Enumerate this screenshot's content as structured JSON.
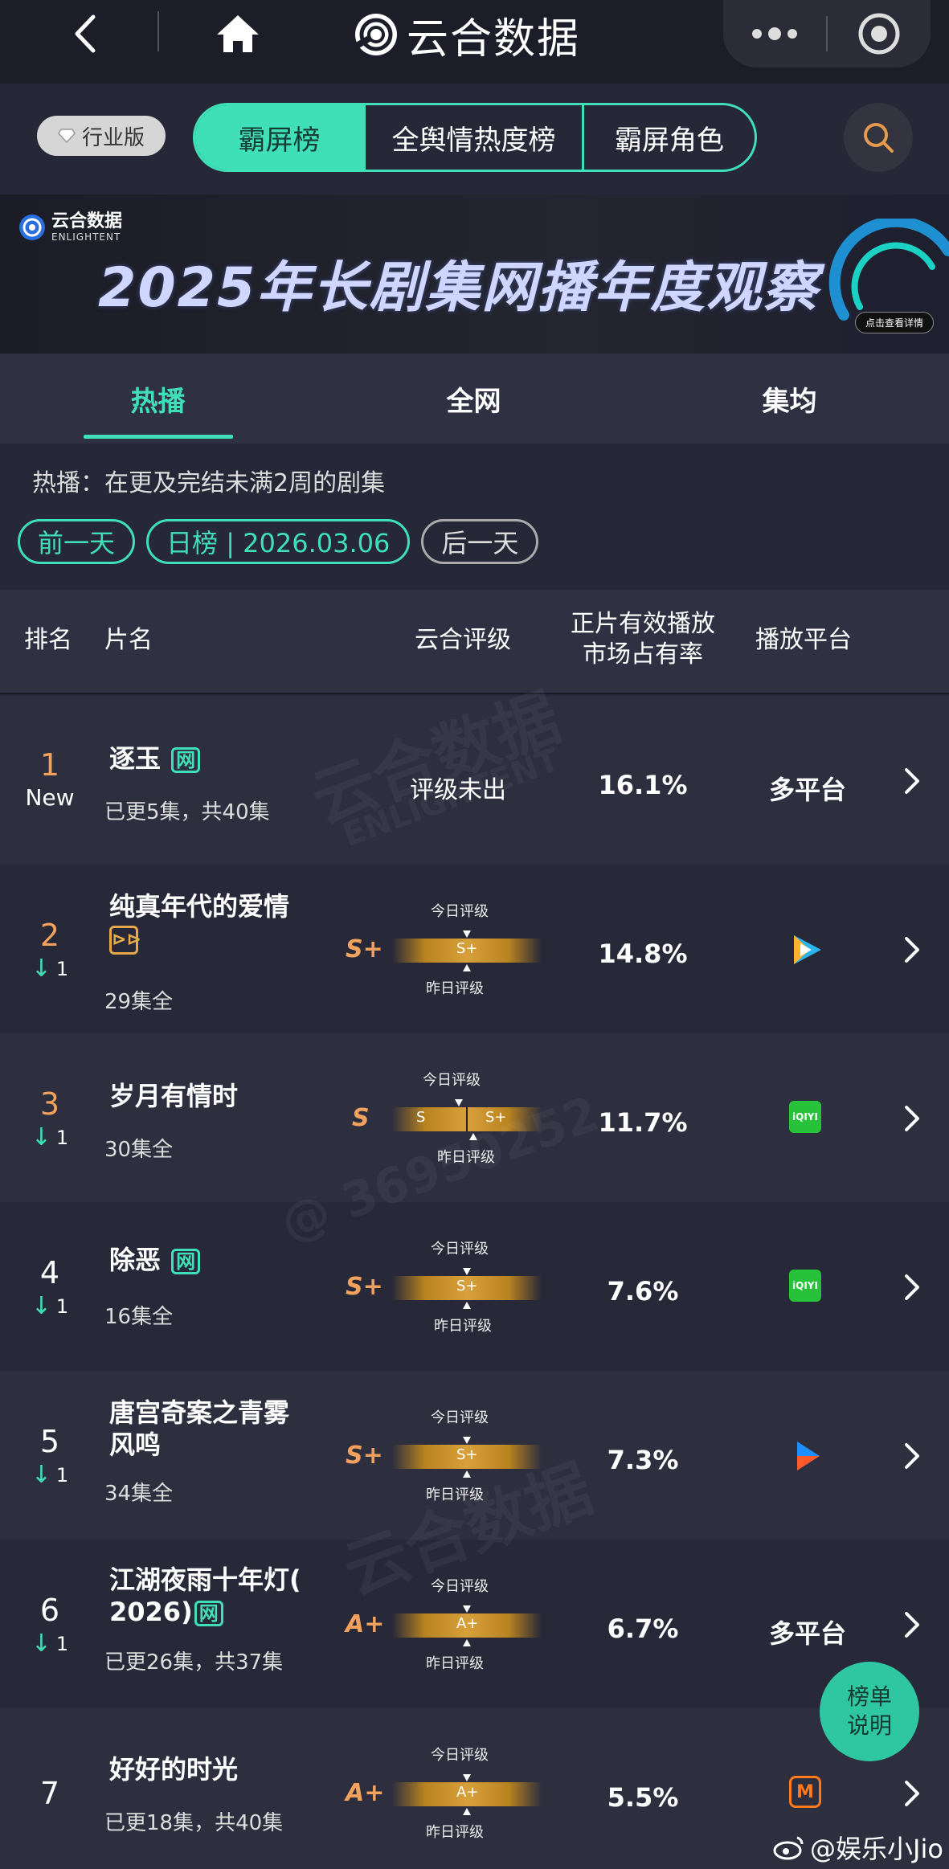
{
  "topnav": {
    "brand_name": "云合数据"
  },
  "tabbar": {
    "edition_label": "行业版",
    "tabs": [
      {
        "label": "霸屏榜",
        "active": true
      },
      {
        "label": "全舆情热度榜",
        "active": false
      },
      {
        "label": "霸屏角色",
        "active": false
      }
    ]
  },
  "banner": {
    "logo_cn": "云合数据",
    "logo_en": "ENLIGHTENT",
    "title": "2025年长剧集网播年度观察",
    "detail_label": "点击查看详情"
  },
  "subtabs": [
    {
      "label": "热播",
      "active": true
    },
    {
      "label": "全网",
      "active": false
    },
    {
      "label": "集均",
      "active": false
    }
  ],
  "description": "热播：在更及完结未满2周的剧集",
  "datebar": {
    "prev_label": "前一天",
    "current_label": "日榜 | 2026.03.06",
    "next_label": "后一天"
  },
  "table_header": {
    "rank": "排名",
    "title": "片名",
    "grade": "云合评级",
    "share_line1": "正片有效播放",
    "share_line2": "市场占有率",
    "platform": "播放平台"
  },
  "rows": [
    {
      "rank": "1",
      "badge": "New",
      "change": "",
      "title_line1": "逐玉",
      "title_line2": "",
      "tag": "网",
      "episodes": "已更5集，共40集",
      "grade_text": "评级未出",
      "share": "16.1%",
      "platform_text": "多平台",
      "platform_icon": "none"
    },
    {
      "rank": "2",
      "badge": "",
      "change": "1",
      "title_line1": "纯真年代的爱情",
      "title_line2": "",
      "tag": "独播",
      "episodes": "29集全",
      "grade_letter": "S+",
      "grade_today": "S+",
      "grade_yesterday": "",
      "grade_today_label": "今日评级",
      "grade_yesterday_label": "昨日评级",
      "share": "14.8%",
      "platform_text": "",
      "platform_icon": "tencent-video-icon"
    },
    {
      "rank": "3",
      "badge": "",
      "change": "1",
      "title_line1": "岁月有情时",
      "title_line2": "",
      "tag": "",
      "episodes": "30集全",
      "grade_letter": "S",
      "grade_today": "S",
      "grade_yesterday": "S+",
      "grade_today_label": "今日评级",
      "grade_yesterday_label": "昨日评级",
      "share": "11.7%",
      "platform_text": "",
      "platform_icon": "iqiyi-icon",
      "platform_icon_label": "iQIYI"
    },
    {
      "rank": "4",
      "badge": "",
      "change": "1",
      "title_line1": "除恶",
      "title_line2": "",
      "tag": "网",
      "episodes": "16集全",
      "grade_letter": "S+",
      "grade_today": "S+",
      "grade_yesterday": "",
      "grade_today_label": "今日评级",
      "grade_yesterday_label": "昨日评级",
      "share": "7.6%",
      "platform_text": "",
      "platform_icon": "iqiyi-icon",
      "platform_icon_label": "iQIYI"
    },
    {
      "rank": "5",
      "badge": "",
      "change": "1",
      "title_line1": "唐宫奇案之青雾",
      "title_line2": "风鸣",
      "tag": "",
      "episodes": "34集全",
      "grade_letter": "S+",
      "grade_today": "S+",
      "grade_yesterday": "",
      "grade_today_label": "今日评级",
      "grade_yesterday_label": "昨日评级",
      "share": "7.3%",
      "platform_text": "",
      "platform_icon": "youku-icon"
    },
    {
      "rank": "6",
      "badge": "",
      "change": "1",
      "title_line1": "江湖夜雨十年灯(",
      "title_line2": "2026)",
      "tag": "网",
      "episodes": "已更26集，共37集",
      "grade_letter": "A+",
      "grade_today": "A+",
      "grade_yesterday": "",
      "grade_today_label": "今日评级",
      "grade_yesterday_label": "昨日评级",
      "share": "6.7%",
      "platform_text": "多平台",
      "platform_icon": "none"
    },
    {
      "rank": "7",
      "badge": "",
      "change": "",
      "title_line1": "好好的时光",
      "title_line2": "",
      "tag": "",
      "episodes": "已更18集，共40集",
      "grade_letter": "A+",
      "grade_today": "A+",
      "grade_yesterday": "",
      "grade_today_label": "今日评级",
      "grade_yesterday_label": "昨日评级",
      "share": "5.5%",
      "platform_text": "",
      "platform_icon": "mango-tv-icon"
    }
  ],
  "float_button": {
    "line1": "榜单",
    "line2": "说明"
  },
  "credit": "@娱乐小Jio",
  "watermark": {
    "cn": "云合数据",
    "en": "ENLIGHTENT",
    "id": "@ 36950252"
  },
  "colors": {
    "accent": "#3fe0b7",
    "rank_top": "#f2a25c",
    "grade": "#f2a25c",
    "background": "#262838"
  }
}
